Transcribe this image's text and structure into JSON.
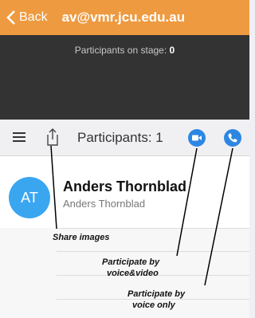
{
  "nav": {
    "back_label": "Back",
    "title": "av@vmr.jcu.edu.au"
  },
  "stage": {
    "label": "Participants on stage:",
    "count": "0"
  },
  "toolbar": {
    "title": "Participants: 1"
  },
  "participant": {
    "initials": "AT",
    "name": "Anders Thornblad",
    "subtitle": "Anders Thornblad"
  },
  "annotations": {
    "share": "Share images",
    "video_1": "Participate by",
    "video_2": "voice&video",
    "voice_1": "Participate by",
    "voice_2": "voice only"
  },
  "colors": {
    "nav": "#ee9a40",
    "stage": "#333333",
    "accent": "#2c87e2",
    "avatar": "#3aa6f0"
  }
}
